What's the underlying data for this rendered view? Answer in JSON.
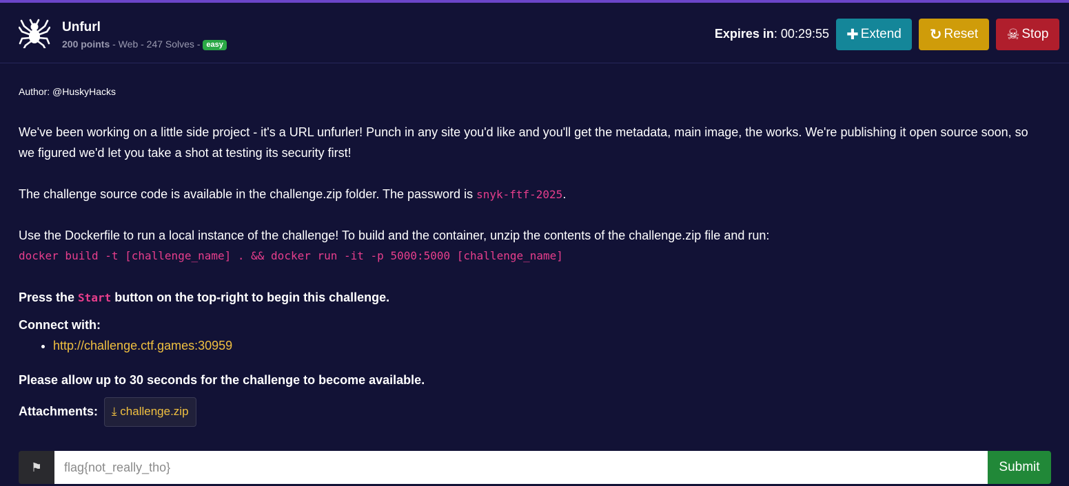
{
  "challenge": {
    "title": "Unfurl",
    "points": "200 points",
    "meta_rest": " - Web - 247 Solves - ",
    "difficulty": "easy"
  },
  "timer": {
    "label": "Expires in",
    "value": ": 00:29:55"
  },
  "buttons": {
    "extend": "Extend",
    "reset": "Reset",
    "stop": "Stop"
  },
  "description": {
    "author": "Author: @HuskyHacks",
    "intro": "We've been working on a little side project - it's a URL unfurler! Punch in any site you'd like and you'll get the metadata, main image, the works. We're publishing it open source soon, so we figured we'd let you take a shot at testing its security first!",
    "source_text": "The challenge source code is available in the challenge.zip folder. The password is ",
    "password": "snyk-ftf-2025",
    "source_end": ".",
    "docker_text": "Use the Dockerfile to run a local instance of the challenge! To build and the container, unzip the contents of the challenge.zip file and run:",
    "docker_cmd": "docker build -t [challenge_name] . && docker run -it -p 5000:5000 [challenge_name]",
    "press_before": "Press the ",
    "press_code": "Start",
    "press_after": " button on the top-right to begin this challenge.",
    "connect_label": "Connect with:",
    "connect_url": "http://challenge.ctf.games:30959",
    "allow_text": "Please allow up to 30 seconds for the challenge to become available.",
    "attachments_label": "Attachments:",
    "attachment_file": "challenge.zip"
  },
  "flag_form": {
    "placeholder": "flag{not_really_tho}",
    "submit": "Submit"
  },
  "icons": {
    "logo": "spider-icon",
    "extend": "plus-icon",
    "reset": "redo-icon",
    "stop": "skull-crossbones-icon",
    "attachment": "download-icon",
    "flag": "checkered-flag-icon"
  },
  "colors": {
    "background": "#121236",
    "accent_top": "#6b45c9",
    "extend": "#148699",
    "reset": "#cf9c0a",
    "stop": "#b01e2c",
    "submit": "#218838",
    "code": "#e83e8c",
    "link": "#f0c040",
    "badge": "#2aa845"
  }
}
